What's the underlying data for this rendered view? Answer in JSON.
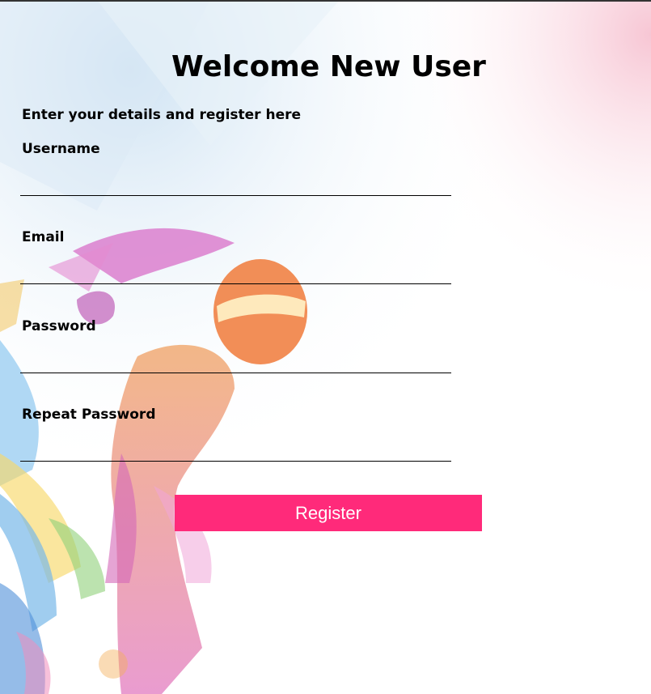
{
  "page": {
    "title": "Welcome New User",
    "subtitle": "Enter your details and register here"
  },
  "form": {
    "username_label": "Username",
    "username_value": "",
    "email_label": "Email",
    "email_value": "",
    "password_label": "Password",
    "password_value": "",
    "repeat_password_label": "Repeat Password",
    "repeat_password_value": "",
    "register_label": "Register"
  },
  "colors": {
    "button_background": "#ff2a7a",
    "button_text": "#ffffff",
    "text": "#000000"
  },
  "background": {
    "artwork": "colorful-splash-illustration"
  }
}
